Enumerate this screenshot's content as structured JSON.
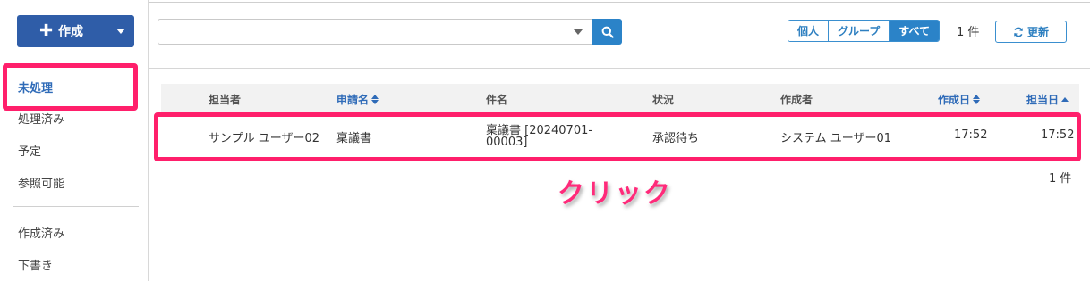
{
  "toolbar": {
    "create_label": "作成",
    "search": {
      "value": "",
      "placeholder": ""
    },
    "filter_tabs": [
      {
        "label": "個人",
        "selected": false
      },
      {
        "label": "グループ",
        "selected": false
      },
      {
        "label": "すべて",
        "selected": true
      }
    ],
    "count_label": "1 件",
    "refresh_label": "更新"
  },
  "sidebar": {
    "items": [
      {
        "label": "未処理",
        "active": true
      },
      {
        "label": "処理済み",
        "active": false
      },
      {
        "label": "予定",
        "active": false
      },
      {
        "label": "参照可能",
        "active": false
      },
      {
        "label": "作成済み",
        "active": false
      },
      {
        "label": "下書き",
        "active": false
      }
    ]
  },
  "table": {
    "columns": [
      {
        "label": "担当者",
        "sortable": false
      },
      {
        "label": "申請名",
        "sortable": true,
        "sort": "both"
      },
      {
        "label": "件名",
        "sortable": false
      },
      {
        "label": "状況",
        "sortable": false
      },
      {
        "label": "作成者",
        "sortable": false
      },
      {
        "label": "作成日",
        "sortable": true,
        "sort": "both"
      },
      {
        "label": "担当日",
        "sortable": true,
        "sort": "asc"
      }
    ],
    "rows": [
      {
        "assignee": "サンプル ユーザー02",
        "application_name": "稟議書",
        "subject_line1": "稟議書 [20240701-",
        "subject_line2": "00003]",
        "status": "承認待ち",
        "creator": "システム ユーザー01",
        "created": "17:52",
        "assigned": "17:52"
      }
    ]
  },
  "footer": {
    "count_label": "1 件"
  },
  "annotation": {
    "label": "クリック",
    "color": "#ff1f6b"
  },
  "colors": {
    "primary": "#2f5da8",
    "accent": "#2b83c8",
    "link": "#2f6bb8",
    "highlight": "#ff1f6b"
  }
}
